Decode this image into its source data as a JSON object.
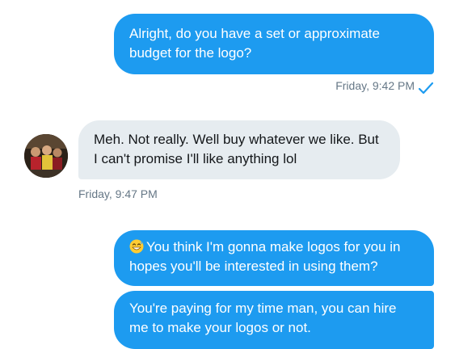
{
  "conversation": {
    "messages": [
      {
        "text": "Alright, do you have a set or approximate budget for the logo?"
      },
      {
        "text": "Meh. Not really. Well buy whatever we like. But I can't promise I'll like anything lol"
      },
      {
        "text": "You think I'm gonna make logos for you in hopes you'll be interested in using them?"
      },
      {
        "text": "You're paying for my time man, you can hire me to make your logos or not."
      }
    ],
    "timestamps": [
      "Friday, 9:42 PM",
      "Friday, 9:47 PM"
    ],
    "read_receipt_icon": "checkmark-icon",
    "emoji_icon": "grinning-sweat-emoji",
    "colors": {
      "outgoing_bubble": "#1d9bf0",
      "incoming_bubble": "#e6ecf0",
      "timestamp": "#657786",
      "checkmark": "#1d9bf0"
    }
  }
}
